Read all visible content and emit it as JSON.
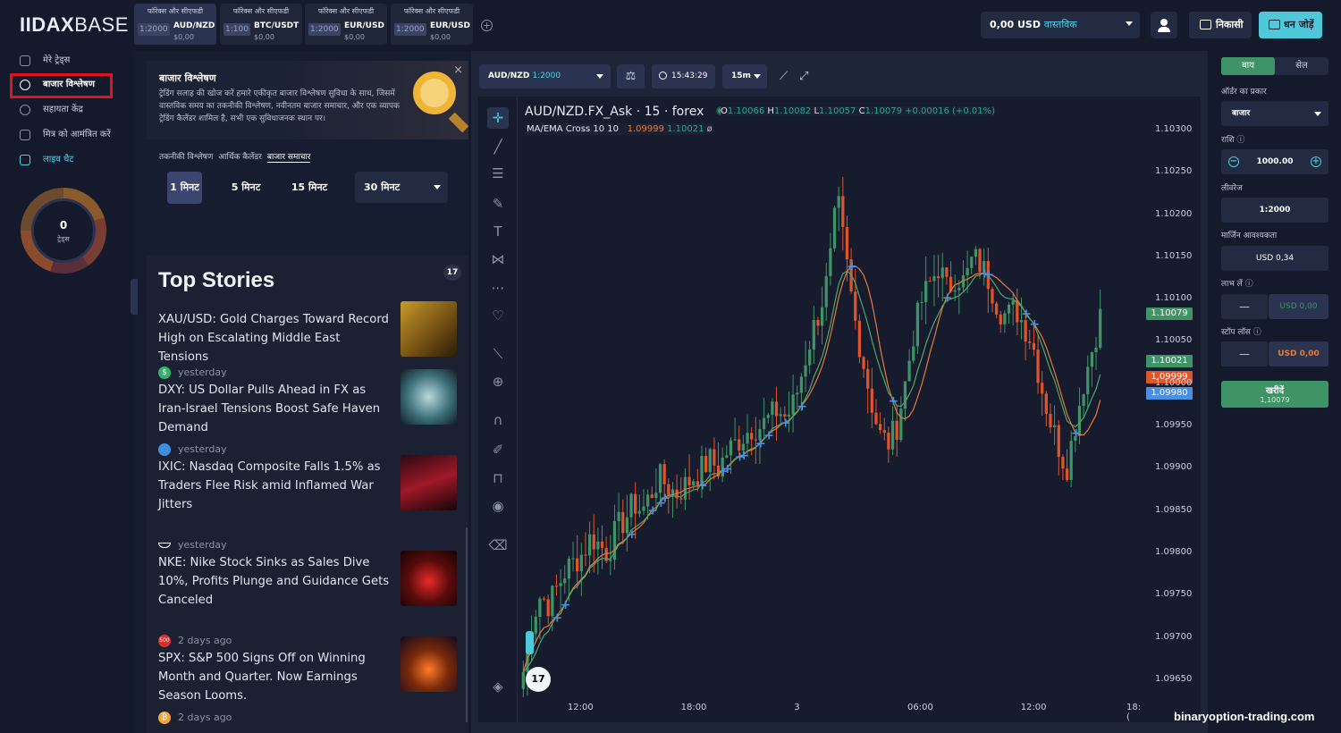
{
  "brand": {
    "logo_bold": "IIDAX",
    "logo_light": "BASE"
  },
  "asset_tabs": [
    {
      "header": "फॉरेक्स और सीएफडी",
      "leverage": "1:2000",
      "pair": "AUD/NZD",
      "amount": "$0,00",
      "active": true
    },
    {
      "header": "फॉरेक्स और सीएफडी",
      "leverage": "1:100",
      "pair": "BTC/USDT",
      "amount": "$0,00",
      "active": false
    },
    {
      "header": "फॉरेक्स और सीएफडी",
      "leverage": "1:2000",
      "pair": "EUR/USD",
      "amount": "$0,00",
      "active": false
    },
    {
      "header": "फॉरेक्स और सीएफडी",
      "leverage": "1:2000",
      "pair": "EUR/USD",
      "amount": "$0,00",
      "active": false
    }
  ],
  "header": {
    "balance": "0,00 USD",
    "account_type": "वास्तविक",
    "withdraw": "निकासी",
    "deposit": "धन जोड़ें"
  },
  "sidebar": {
    "items": [
      {
        "label": "मेरे ट्रेड्स"
      },
      {
        "label": "बाजार विश्लेषण"
      },
      {
        "label": "सहायता केंद्र"
      },
      {
        "label": "मित्र को आमंत्रित करें"
      },
      {
        "label": "लाइव चैट"
      }
    ],
    "trades_count": "0",
    "trades_label": "ट्रेड्स"
  },
  "analysis": {
    "promo_title": "बाजार विश्लेषण",
    "promo_text": "ट्रेडिंग सलाह की खोज करें हमारे एकीकृत बाजार विश्लेषण सुविधा के साथ, जिसमें वास्तविक समय का तकनीकी विश्लेषण, नवीनतम बाजार समाचार, और एक व्यापक ट्रेडिंग कैलेंडर शामिल है, सभी एक सुविधाजनक स्थान पर।",
    "close": "×",
    "subtabs": [
      "तकनीकी विश्लेषण",
      "आर्थिक कैलेंडर",
      "बाजार समाचार"
    ],
    "timeframes": [
      "1 मिनट",
      "5 मिनट",
      "15 मिनट"
    ],
    "timeframe_select": "30 मिनट",
    "news_heading": "Top Stories",
    "tv": "17",
    "stories": [
      {
        "source": "",
        "title": "XAU/USD: Gold Charges Toward Record High on Escalating Middle East Tensions"
      },
      {
        "source": "yesterday",
        "title": "DXY: US Dollar Pulls Ahead in FX as Iran-Israel Tensions Boost Safe Haven Demand"
      },
      {
        "source": "yesterday",
        "title": "IXIC: Nasdaq Composite Falls 1.5% as Traders Flee Risk amid Inflamed War Jitters"
      },
      {
        "source": "yesterday",
        "title": "NKE: Nike Stock Sinks as Sales Dive 10%, Profits Plunge and Guidance Gets Canceled"
      },
      {
        "source": "2 days ago",
        "title": "SPX: S&P 500 Signs Off on Winning Month and Quarter. Now Earnings Season Looms."
      },
      {
        "source": "2 days ago",
        "title": ""
      }
    ],
    "source_badges": [
      "$",
      "",
      "",
      "500",
      "₿"
    ]
  },
  "chart_toolbar": {
    "symbol": "AUD/NZD",
    "leverage": "1:2000",
    "time": "15:43:29",
    "interval": "15m"
  },
  "chart_legend": {
    "title": "AUD/NZD.FX_Ask · 15 · forex",
    "o": "1.10066",
    "h": "1.10082",
    "l": "1.10057",
    "c": "1.10079",
    "chg": "+0.00016 (+0.01%)",
    "ma_label": "MA/EMA Cross 10 10",
    "ma1": "1.09999",
    "ma2": "1.10021",
    "ma3": "ø"
  },
  "price_tags": {
    "last": "1.10079",
    "ema": "1.10021",
    "ma": "1.09999",
    "bid": "1.09980"
  },
  "colors": {
    "up": "#3e9466",
    "down": "#e0542a",
    "ma": "#e57c3a",
    "ema": "#4ea86b",
    "cross": "#4a90e2",
    "accent": "#4fc9d9"
  },
  "chart_data": {
    "type": "candlestick",
    "title": "AUD/NZD.FX_Ask · 15 · forex",
    "x_ticks": [
      "12:00",
      "18:00",
      "3",
      "06:00",
      "12:00",
      "18:("
    ],
    "y_ticks": [
      "1.10300",
      "1.10250",
      "1.10200",
      "1.10150",
      "1.10100",
      "1.10050",
      "1.10000",
      "1.09950",
      "1.09900",
      "1.09850",
      "1.09800",
      "1.09750",
      "1.09700",
      "1.09650"
    ],
    "ylim": [
      1.0963,
      1.1034
    ],
    "close_path": [
      1.0966,
      1.0972,
      1.0975,
      1.0974,
      1.0976,
      1.0978,
      1.0979,
      1.098,
      1.0982,
      1.0981,
      1.098,
      1.0983,
      1.0984,
      1.0986,
      1.0985,
      1.0987,
      1.0989,
      1.0988,
      1.0987,
      1.0988,
      1.0989,
      1.099,
      1.0991,
      1.099,
      1.0992,
      1.0993,
      1.0994,
      1.0995,
      1.0995,
      1.0996,
      1.0997,
      1.0996,
      1.0998,
      1.1002,
      1.1006,
      1.1009,
      1.1013,
      1.1022,
      1.1015,
      1.1008,
      1.1003,
      1.0998,
      1.0994,
      1.0993,
      1.0995,
      1.1,
      1.1006,
      1.101,
      1.1012,
      1.1014,
      1.1011,
      1.1013,
      1.1012,
      1.1015,
      1.1014,
      1.1012,
      1.1009,
      1.1008,
      1.1009,
      1.1007,
      1.1005,
      1.1,
      1.0996,
      1.0993,
      1.099,
      1.0995,
      1.1,
      1.1004,
      1.1008
    ]
  },
  "order_panel": {
    "buy_tab": "बाय",
    "sell_tab": "सेल",
    "order_type_label": "ऑर्डर का प्रकार",
    "order_type": "बाजार",
    "amount_label": "राशि ⓘ",
    "amount": "1000.00",
    "leverage_label": "लीवरेज",
    "leverage": "1:2000",
    "margin_label": "मार्जिन आवश्यकता",
    "margin": "USD 0,34",
    "tp_label": "लाभ लें ⓘ",
    "tp": "USD 0,00",
    "sl_label": "स्टॉप लॉस ⓘ",
    "sl": "USD 0,00",
    "buy_button": "खरीदें",
    "buy_price": "1,10079",
    "minus": "—",
    "minus_icon": "−",
    "plus_icon": "+"
  },
  "watermark": "binaryoption-trading.com"
}
